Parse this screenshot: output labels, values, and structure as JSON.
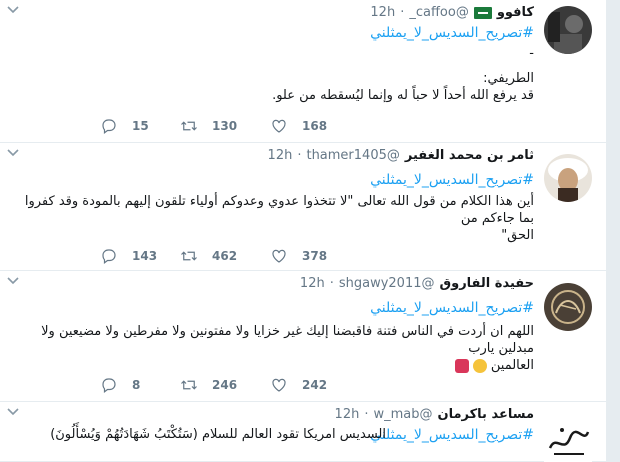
{
  "colors": {
    "link": "#1da1f2",
    "muted": "#657786",
    "background": "#e6ecf0"
  },
  "tweets": [
    {
      "name": "كافوو",
      "handle": "@caffoo_",
      "dot": "·",
      "time": "12h",
      "hashtag": "#تصريح_السديس_لا_يمثلني",
      "lines": [
        "-",
        "الطريفي:",
        "قد يرفع الله أحداً لا حباً له وإنما ليُسقطه من علو."
      ],
      "replies": "15",
      "retweets": "130",
      "likes": "168",
      "avatar_icon": "avatar-photo"
    },
    {
      "name": "ثامر بن محمد الغفير",
      "handle": "@thamer1405",
      "dot": "·",
      "time": "12h",
      "hashtag": "#تصريح_السديس_لا_يمثلني",
      "lines": [
        "أين هذا الكلام من قول الله تعالى \"لا تتخذوا عدوي وعدوكم أولياء تلقون إليهم بالمودة وقد كفروا بما جاءكم من",
        "الحق\""
      ],
      "replies": "143",
      "retweets": "462",
      "likes": "378",
      "avatar_icon": "avatar-photo"
    },
    {
      "name": "حفيدة الفاروق",
      "handle": "@shgawy2011",
      "dot": "·",
      "time": "12h",
      "hashtag": "#تصريح_السديس_لا_يمثلني",
      "lines": [
        "اللهم ان أردت في الناس فتنة فاقبضنا إليك غير خزايا ولا مفتونين ولا مفرطين ولا مضيعين ولا مبدلين يارب",
        "العالمين"
      ],
      "replies": "8",
      "retweets": "246",
      "likes": "242",
      "avatar_icon": "avatar-calligraphy"
    },
    {
      "name": "مساعد باكرمان",
      "handle": "@w_mab",
      "dot": "·",
      "time": "12h",
      "hashtag": "#تصريح_السديس_لا_يمثلني",
      "lines": [
        "السديس امريكا تقود العالم للسلام (سَتُكْتَبُ شَهَادَتُهُمْ وَيُسْأَلُونَ)"
      ],
      "avatar_icon": "avatar-calligraphy"
    }
  ]
}
